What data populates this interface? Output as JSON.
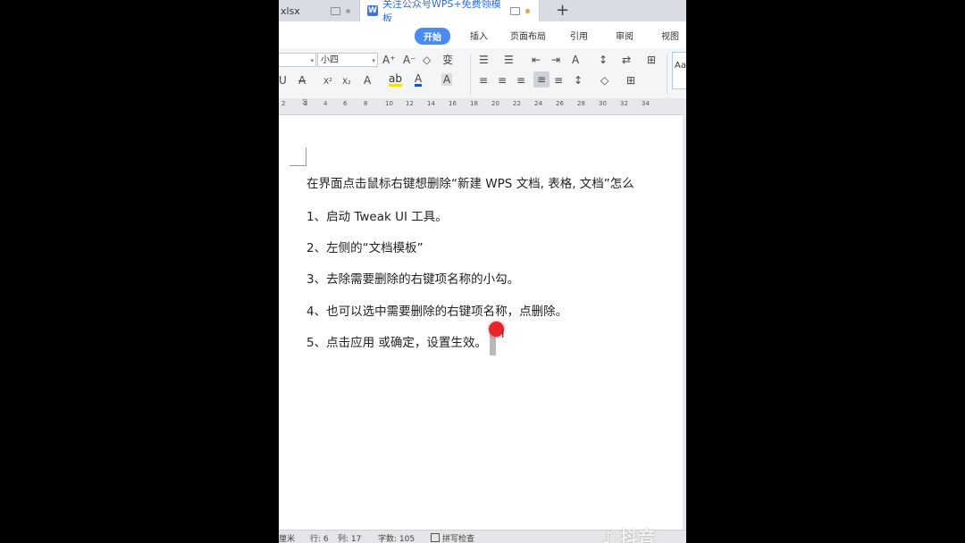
{
  "tabs": [
    {
      "label": "xlsx"
    },
    {
      "label": "关注公众号WPS+免费领模板"
    }
  ],
  "new_tab_symbol": "+",
  "menu": [
    "开始",
    "插入",
    "页面布局",
    "引用",
    "审阅",
    "视图"
  ],
  "toolbar": {
    "font_size": "小四",
    "style_preview": "Aa"
  },
  "ruler_ticks": [
    "2",
    "2",
    "4",
    "6",
    "8",
    "10",
    "12",
    "14",
    "16",
    "18",
    "20",
    "22",
    "24",
    "26",
    "28",
    "30",
    "32",
    "34"
  ],
  "document": {
    "lines": [
      "在界面点击鼠标右键想删除“新建 WPS 文档, 表格, 文档”怎么",
      "1、启动 Tweak UI 工具。",
      "2、左侧的“文档模板”",
      "3、去除需要删除的右键项名称的小勾。",
      "4、也可以选中需要删除的右键项名称，点删除。",
      "5、点击应用  或确定，设置生效。"
    ]
  },
  "status": {
    "unit": "厘米",
    "row": "行: 6",
    "col": "列: 17",
    "word_count": "字数: 105",
    "spell_check": "拼写检查"
  },
  "watermark": "抖音",
  "colors": {
    "accent": "#4a8cf2",
    "cursor_dot": "#e8242c"
  }
}
